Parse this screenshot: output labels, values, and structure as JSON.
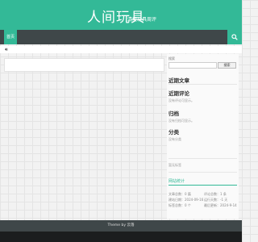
{
  "site": {
    "title": "人间玩具",
    "subtitle": "清瘦玩具周评"
  },
  "nav": {
    "home_label": "首页"
  },
  "notice": {
    "icon": "speaker-icon"
  },
  "sidebar": {
    "search_label": "搜索",
    "search_placeholder": "",
    "search_button": "搜索",
    "recent_posts_title": "近期文章",
    "recent_comments_title": "近期评论",
    "recent_comments_empty": "没有评论可显示。",
    "archives_title": "归档",
    "archives_empty": "没有归档可显示。",
    "categories_title": "分类",
    "categories_empty": "没有分类",
    "misc_text": "暂无标签",
    "stats": {
      "title": "网站统计",
      "articles": "文章总数：0 篇",
      "comments": "评论总数：1 条",
      "views": "建站日期：2024-09-16",
      "run_days": "运行天数：-1 天",
      "tags": "标签总数：0 个",
      "updated": "最后更新：2024-9-14"
    }
  },
  "footer": {
    "text": "Theme by 云落"
  },
  "colors": {
    "accent": "#33b997",
    "nav_bg": "#3f4749",
    "bottom_bg": "#1b1d1e"
  }
}
